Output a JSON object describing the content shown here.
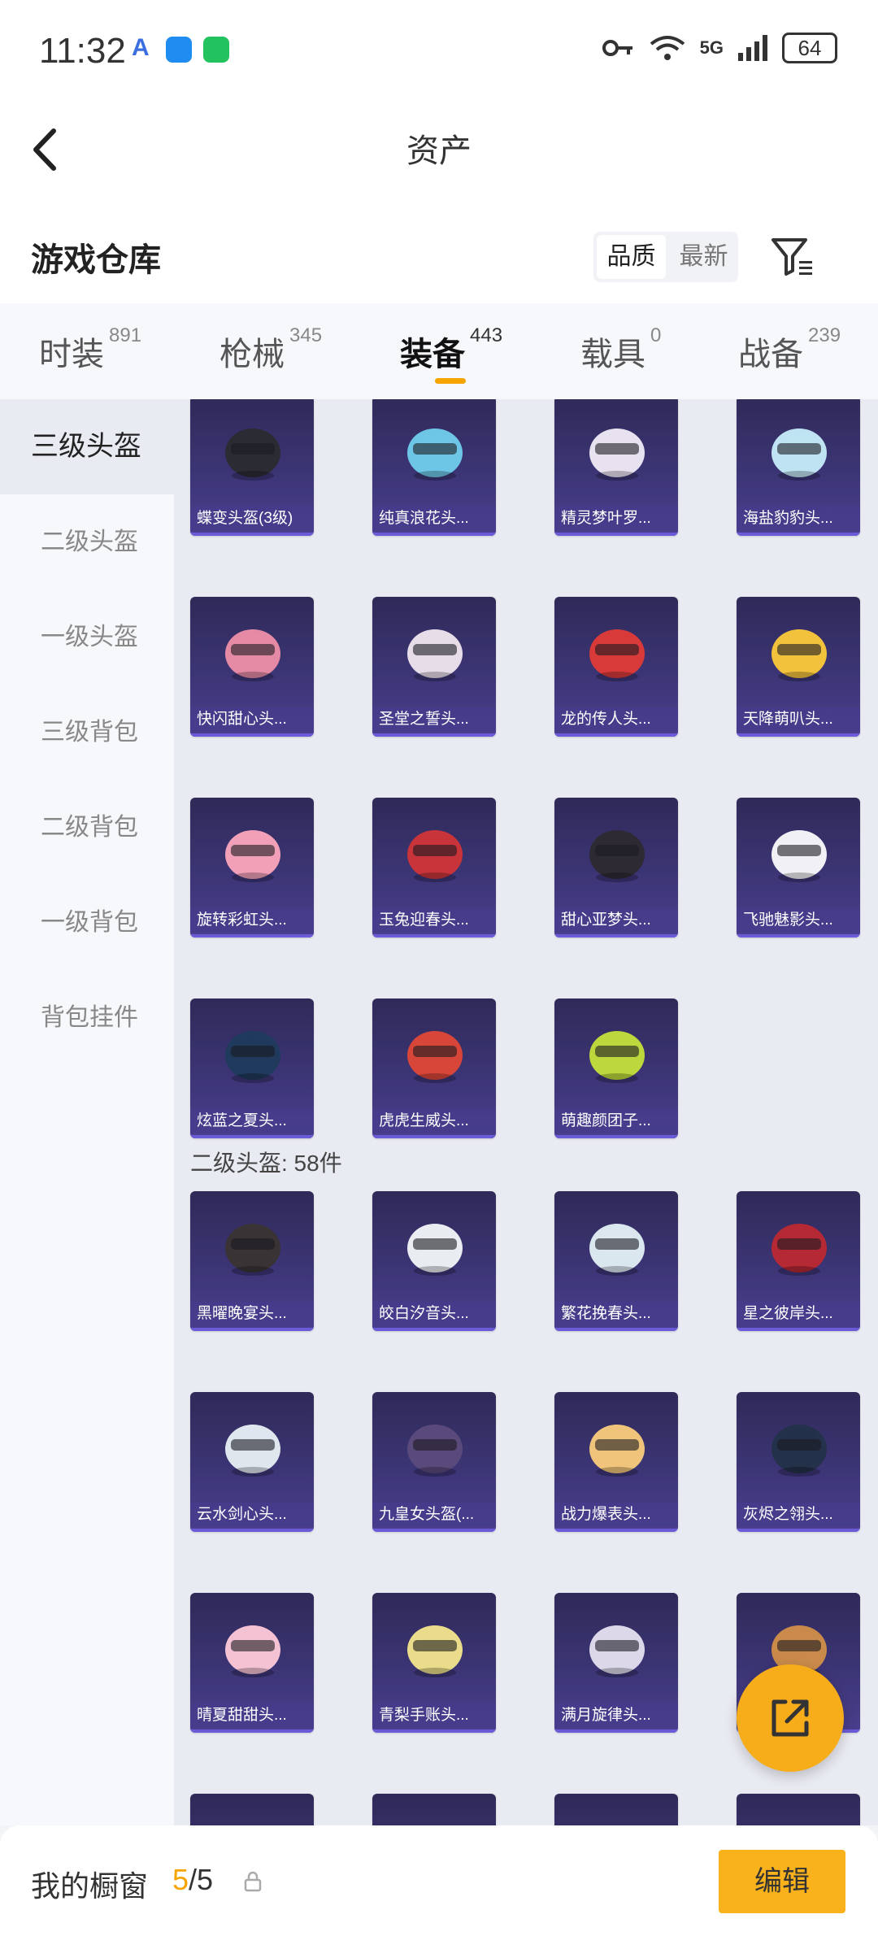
{
  "status": {
    "time": "11:32",
    "network": "5G",
    "battery": "64"
  },
  "nav": {
    "title": "资产"
  },
  "warehouse": {
    "title": "游戏仓库",
    "sort_quality": "品质",
    "sort_latest": "最新"
  },
  "tabs": [
    {
      "label": "时装",
      "count": "891"
    },
    {
      "label": "枪械",
      "count": "345"
    },
    {
      "label": "装备",
      "count": "443"
    },
    {
      "label": "载具",
      "count": "0"
    },
    {
      "label": "战备",
      "count": "239"
    }
  ],
  "sidebar": [
    {
      "label": "三级头盔"
    },
    {
      "label": "二级头盔"
    },
    {
      "label": "一级头盔"
    },
    {
      "label": "三级背包"
    },
    {
      "label": "二级背包"
    },
    {
      "label": "一级背包"
    },
    {
      "label": "背包挂件"
    }
  ],
  "section2": {
    "title": "二级头盔: 58件"
  },
  "items_level3": [
    {
      "name": "蝶变头盔(3级)",
      "color": "#2b2b33"
    },
    {
      "name": "纯真浪花头...",
      "color": "#6ec6e6"
    },
    {
      "name": "精灵梦叶罗...",
      "color": "#e8e2f0"
    },
    {
      "name": "海盐豹豹头...",
      "color": "#bfe3f2"
    },
    {
      "name": "快闪甜心头...",
      "color": "#e58aa5"
    },
    {
      "name": "圣堂之誓头...",
      "color": "#e7dde9"
    },
    {
      "name": "龙的传人头...",
      "color": "#d83a3a"
    },
    {
      "name": "天降萌叭头...",
      "color": "#f3c23d"
    },
    {
      "name": "旋转彩虹头...",
      "color": "#f2a0b8"
    },
    {
      "name": "玉兔迎春头...",
      "color": "#c8343a"
    },
    {
      "name": "甜心亚梦头...",
      "color": "#2e2a33"
    },
    {
      "name": "飞驰魅影头...",
      "color": "#f0f0f5"
    },
    {
      "name": "炫蓝之夏头...",
      "color": "#1f3a5c"
    },
    {
      "name": "虎虎生威头...",
      "color": "#d8463a"
    },
    {
      "name": "萌趣颜团子...",
      "color": "#bcd83c"
    }
  ],
  "items_level2": [
    {
      "name": "黑曜晚宴头...",
      "color": "#3a3336"
    },
    {
      "name": "皎白汐音头...",
      "color": "#e9ecf1"
    },
    {
      "name": "繁花挽春头...",
      "color": "#dbe7ef"
    },
    {
      "name": "星之彼岸头...",
      "color": "#b52935"
    },
    {
      "name": "云水剑心头...",
      "color": "#dfe6ee"
    },
    {
      "name": "九皇女头盔(...",
      "color": "#5a4a7c"
    },
    {
      "name": "战力爆表头...",
      "color": "#f0c47a"
    },
    {
      "name": "灰烬之翎头...",
      "color": "#24314a"
    },
    {
      "name": "晴夏甜甜头...",
      "color": "#f5c2d4"
    },
    {
      "name": "青梨手账头...",
      "color": "#eadc8a"
    },
    {
      "name": "满月旋律头...",
      "color": "#dcd8ea"
    },
    {
      "name": "",
      "color": "#c98a4a"
    }
  ],
  "bottom": {
    "label": "我的橱窗",
    "current": "5",
    "separator": "/",
    "total": "5",
    "edit": "编辑"
  },
  "colors": {
    "accent": "#f5a400",
    "button": "#f9b21c"
  }
}
